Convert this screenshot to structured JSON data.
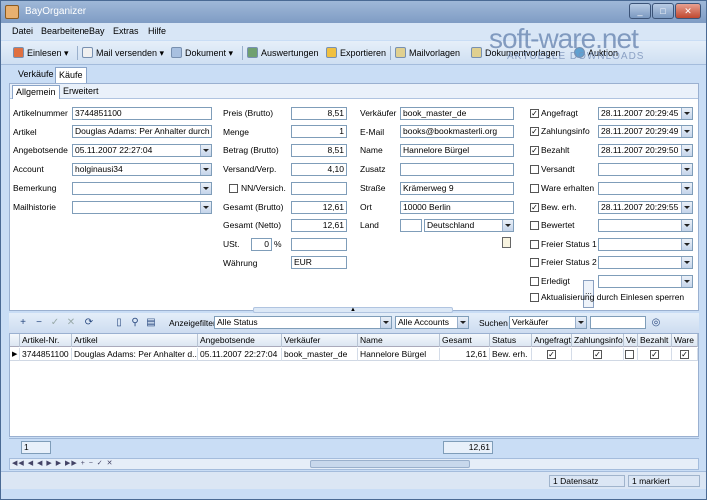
{
  "window": {
    "title": "BayOrganizer",
    "btn_min": "_",
    "btn_max": "□",
    "btn_close": "✕"
  },
  "watermark": {
    "main": "soft-ware.net",
    "sub": "AKTUELLE DOWNLOADS"
  },
  "menu": [
    "Datei",
    "Bearbeiten",
    "eBay",
    "Extras",
    "Hilfe"
  ],
  "toolbar": {
    "einlesen": "Einlesen ▾",
    "mail": "Mail versenden ▾",
    "dokument": "Dokument ▾",
    "auswertungen": "Auswertungen",
    "exportieren": "Exportieren",
    "mailvorlagen": "Mailvorlagen",
    "dokumentvorlagen": "Dokumentvorlagen",
    "auktion": "Auktion"
  },
  "main_tabs": [
    "Verkäufe",
    "Käufe"
  ],
  "sub_tabs": [
    "Allgemein",
    "Erweitert"
  ],
  "left": {
    "labels": [
      "Artikelnummer",
      "Artikel",
      "Angebotsende",
      "Account",
      "Bemerkung",
      "Mailhistorie"
    ],
    "artikelnummer": "3744851100",
    "artikel": "Douglas Adams: Per Anhalter durch di",
    "angebotsende": "05.11.2007 22:27:04",
    "account": "holginausi34",
    "bemerkung": "",
    "mailhistorie": ""
  },
  "middle": {
    "labels": [
      "Preis (Brutto)",
      "Menge",
      "Betrag (Brutto)",
      "Versand/Verp.",
      "NN/Versich.",
      "Gesamt (Brutto)",
      "Gesamt (Netto)",
      "USt.",
      "Währung"
    ],
    "preis": "8,51",
    "menge": "1",
    "betrag": "8,51",
    "versand": "4,10",
    "gesamt_brutto": "12,61",
    "gesamt_netto": "12,61",
    "ust_value": "0",
    "ust_unit": "%",
    "waehrung": "EUR"
  },
  "right": {
    "labels": [
      "Verkäufer",
      "E-Mail",
      "Name",
      "Zusatz",
      "Straße",
      "Ort",
      "Land"
    ],
    "verkaeufer": "book_master_de",
    "email": "books@bookmasterli.org",
    "name": "Hannelore Bürgel",
    "zusatz": "",
    "strasse": "Krämerweg 9",
    "ort": "10000 Berlin",
    "land": "Deutschland",
    "more_btn": "..."
  },
  "status": {
    "items": [
      {
        "label": "Angefragt",
        "checked": "✓",
        "date": "28.11.2007 20:29:45"
      },
      {
        "label": "Zahlungsinfo",
        "checked": "✓",
        "date": "28.11.2007 20:29:49"
      },
      {
        "label": "Bezahlt",
        "checked": "✓",
        "date": "28.11.2007 20:29:50"
      },
      {
        "label": "Versandt",
        "checked": "",
        "date": ""
      },
      {
        "label": "Ware erhalten",
        "checked": "",
        "date": ""
      },
      {
        "label": "Bew. erh.",
        "checked": "✓",
        "date": "28.11.2007 20:29:55"
      },
      {
        "label": "Bewertet",
        "checked": "",
        "date": ""
      },
      {
        "label": "Freier Status 1",
        "checked": "",
        "date": ""
      },
      {
        "label": "Freier Status 2",
        "checked": "",
        "date": ""
      },
      {
        "label": "Erledigt",
        "checked": "",
        "date": ""
      }
    ],
    "resync": "Aktualisierung durch Einlesen sperren"
  },
  "gridbar": {
    "anzeigefilter_label": "Anzeigefilter",
    "filter_value": "Alle Status",
    "accounts_value": "Alle Accounts",
    "suchen_label": "Suchen",
    "suchen_field": "Verkäufer",
    "search_value": ""
  },
  "grid": {
    "headers": [
      "Artikel-Nr.",
      "Artikel",
      "Angebotsende",
      "Verkäufer",
      "Name",
      "Gesamt",
      "Status",
      "Angefragt",
      "Zahlungsinfo",
      "Ve",
      "Bezahlt",
      "Ware"
    ],
    "row": [
      "3744851100",
      "Douglas Adams: Per Anhalter d...",
      "05.11.2007 22:27:04",
      "book_master_de",
      "Hannelore Bürgel",
      "12,61",
      "Bew. erh.",
      "✓",
      "✓",
      "",
      "✓",
      "✓"
    ]
  },
  "footer": {
    "count": "1",
    "sum": "12,61"
  },
  "statusbar": {
    "datensatz": "1 Datensatz",
    "markiert": "1 markiert"
  }
}
